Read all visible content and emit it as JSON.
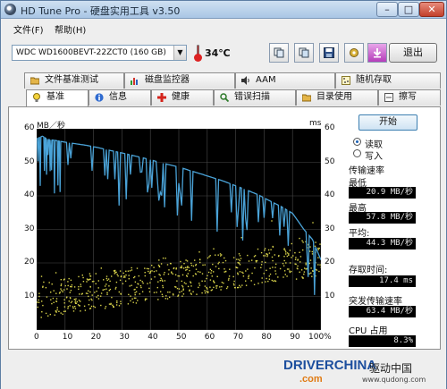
{
  "window": {
    "title": "HD Tune Pro - 硬盘实用工具 v3.50"
  },
  "menu": [
    "文件(F)",
    "帮助(H)"
  ],
  "toolbar": {
    "drive": "WDC WD1600BEVT-22ZCT0 (160 GB)",
    "temperature": "34℃",
    "exit_label": "退出",
    "icons": [
      "copy-icon",
      "copy-icon",
      "save-icon",
      "settings-icon",
      "download-icon"
    ]
  },
  "tabs_top": [
    "文件基准测试",
    "磁盘监控器",
    "AAM",
    "随机存取"
  ],
  "tabs_bottom": [
    "基准",
    "信息",
    "健康",
    "错误扫描",
    "目录使用",
    "擦写"
  ],
  "chart_data": {
    "type": "line",
    "left_axis_label": "MB／秒",
    "right_axis_label": "ms",
    "x_ticks": [
      "0",
      "10",
      "20",
      "30",
      "40",
      "50",
      "60",
      "70",
      "80",
      "90",
      "100%"
    ],
    "y_ticks": [
      "10",
      "20",
      "30",
      "40",
      "50",
      "60"
    ],
    "y_right_ticks": [
      "10",
      "20",
      "30",
      "40",
      "50",
      "60"
    ],
    "xlim": [
      0,
      100
    ],
    "ylim": [
      0,
      60
    ],
    "grid": true,
    "series": [
      {
        "values_x": [
          0,
          2,
          4,
          6,
          8,
          10,
          14,
          18,
          22,
          26,
          30,
          34,
          38,
          42,
          46,
          50,
          54,
          58,
          62,
          66,
          70,
          74,
          78,
          82,
          86,
          90,
          94,
          97,
          100
        ],
        "values_y": [
          57.0,
          57.8,
          56.8,
          56.6,
          56.3,
          56.0,
          55.5,
          55.0,
          54.3,
          53.5,
          52.8,
          52.0,
          51.2,
          50.3,
          49.4,
          48.6,
          47.5,
          46.5,
          45.4,
          44.3,
          43.0,
          41.7,
          40.3,
          38.5,
          36.8,
          34.8,
          30.0,
          27.0,
          20.9
        ]
      }
    ],
    "scatter_note": "access time"
  },
  "controls": {
    "start_label": "开始",
    "read_label": "读取",
    "write_label": "写入"
  },
  "stats": {
    "transfer_title": "传输速率",
    "min_label": "最低",
    "min_value": "20.9 MB/秒",
    "max_label": "最高",
    "max_value": "57.8 MB/秒",
    "avg_label": "平均:",
    "avg_value": "44.3 MB/秒",
    "access_label": "存取时间:",
    "access_value": "17.4 ms",
    "burst_label": "突发传输速率",
    "burst_value": "63.4 MB/秒",
    "cpu_label": "CPU 占用",
    "cpu_value": "8.3%"
  },
  "logo": {
    "driver": "DRIVER",
    "china": "CHINA",
    "com": ".com",
    "cn": "驱动中国",
    "url": "www.qudong.com"
  }
}
